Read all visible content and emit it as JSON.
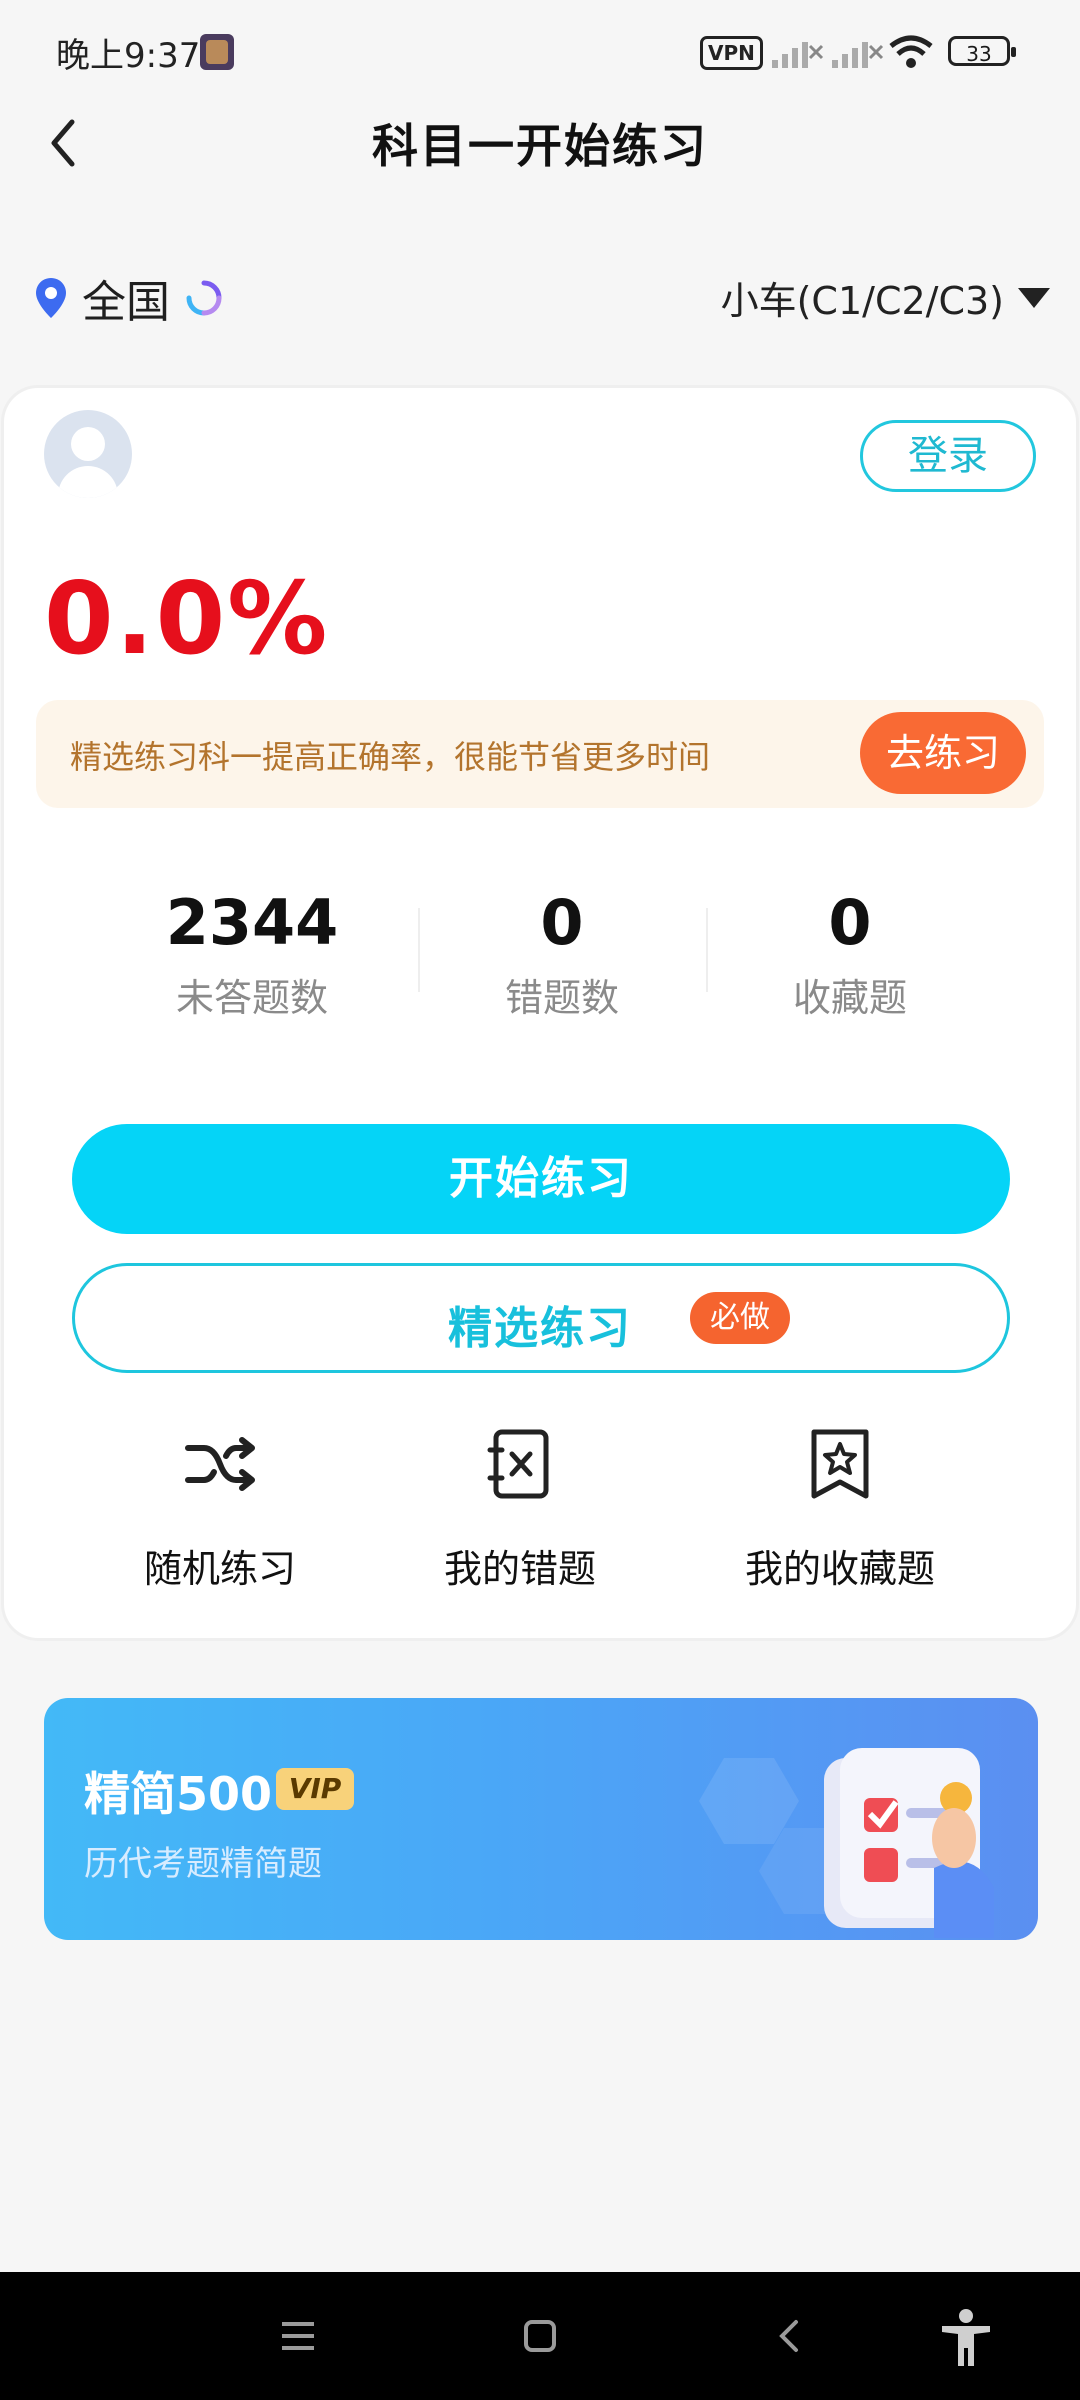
{
  "status_bar": {
    "time": "晚上9:37",
    "vpn": "VPN",
    "battery": "33"
  },
  "header": {
    "title": "科目一开始练习"
  },
  "location": {
    "region": "全国",
    "car_type": "小车(C1/C2/C3)"
  },
  "user": {
    "login_label": "登录",
    "accuracy": "0.0%"
  },
  "promo": {
    "text": "精选练习科一提高正确率，很能节省更多时间",
    "button": "去练习"
  },
  "stats": [
    {
      "value": "2344",
      "label": "未答题数"
    },
    {
      "value": "0",
      "label": "错题数"
    },
    {
      "value": "0",
      "label": "收藏题"
    }
  ],
  "actions": {
    "start": "开始练习",
    "selected": "精选练习",
    "must_badge": "必做"
  },
  "quick_links": [
    {
      "label": "随机练习",
      "icon": "shuffle-icon"
    },
    {
      "label": "我的错题",
      "icon": "wrong-book-icon"
    },
    {
      "label": "我的收藏题",
      "icon": "bookmark-star-icon"
    }
  ],
  "banner": {
    "title": "精简500",
    "badge": "VIP",
    "subtitle": "历代考题精简题"
  },
  "colors": {
    "accent": "#05d4f7",
    "danger": "#e60f1c",
    "orange": "#f96a34"
  }
}
